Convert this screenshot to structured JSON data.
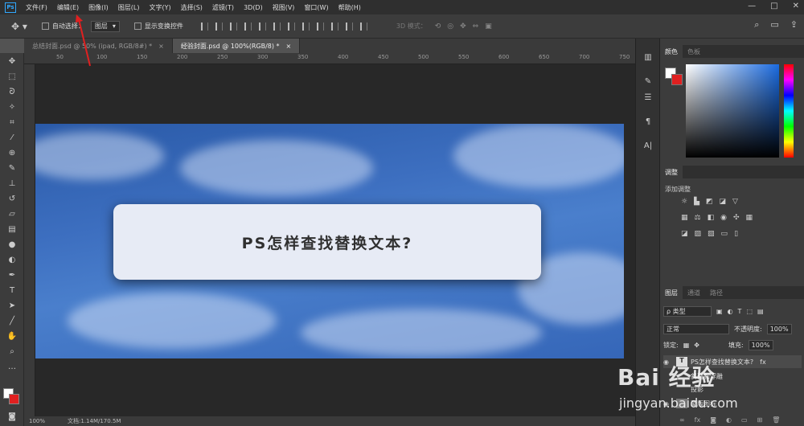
{
  "menubar": {
    "logo": "Ps",
    "items": [
      "文件(F)",
      "编辑(E)",
      "图像(I)",
      "图层(L)",
      "文字(Y)",
      "选择(S)",
      "滤镜(T)",
      "3D(D)",
      "视图(V)",
      "窗口(W)",
      "帮助(H)"
    ],
    "window_buttons": [
      "—",
      "□",
      "✕"
    ]
  },
  "options": {
    "auto_select_label": "自动选择：",
    "auto_select_value": "图层",
    "show_transform_label": "显示变换控件",
    "mode_3d_label": "3D 模式："
  },
  "tabs": [
    {
      "label": "总结封面.psd @ 50% (ipad, RGB/8#) *",
      "close": "×"
    },
    {
      "label": "经验封面.psd @ 100%(RGB/8) *",
      "close": "×"
    }
  ],
  "ruler": {
    "numbers": [
      "50",
      "100",
      "150",
      "200",
      "250",
      "300",
      "350",
      "400",
      "450",
      "500",
      "550",
      "600",
      "650",
      "700",
      "750"
    ]
  },
  "canvas": {
    "card_title": "PS怎样查找替换文本?"
  },
  "status": {
    "zoom": "100%",
    "doc": "文档:1.14M/170.5M"
  },
  "color_panel": {
    "tabs": [
      "颜色",
      "色板"
    ],
    "fg_color": "#ffffff",
    "bg_color": "#e02020"
  },
  "adjust_panel": {
    "tab": "调整",
    "add_label": "添加调整"
  },
  "layers_panel": {
    "tabs": [
      "图层",
      "通道",
      "路径"
    ],
    "kind_label": "ρ 类型",
    "blend_mode": "正常",
    "opacity_label": "不透明度:",
    "opacity_value": "100%",
    "lock_label": "锁定:",
    "fill_label": "填充:",
    "fill_value": "100%",
    "layers": [
      {
        "name": "PS怎样查找替换文本?",
        "type": "text",
        "fx": "fx"
      },
      {
        "name": "斜面和浮雕",
        "type": "effect"
      },
      {
        "name": "投影",
        "type": "effect"
      },
      {
        "name": "蒙版图标",
        "type": "layer"
      }
    ]
  },
  "watermark": {
    "logo": "Bai 经验",
    "url": "jingyan.baidu.com"
  }
}
